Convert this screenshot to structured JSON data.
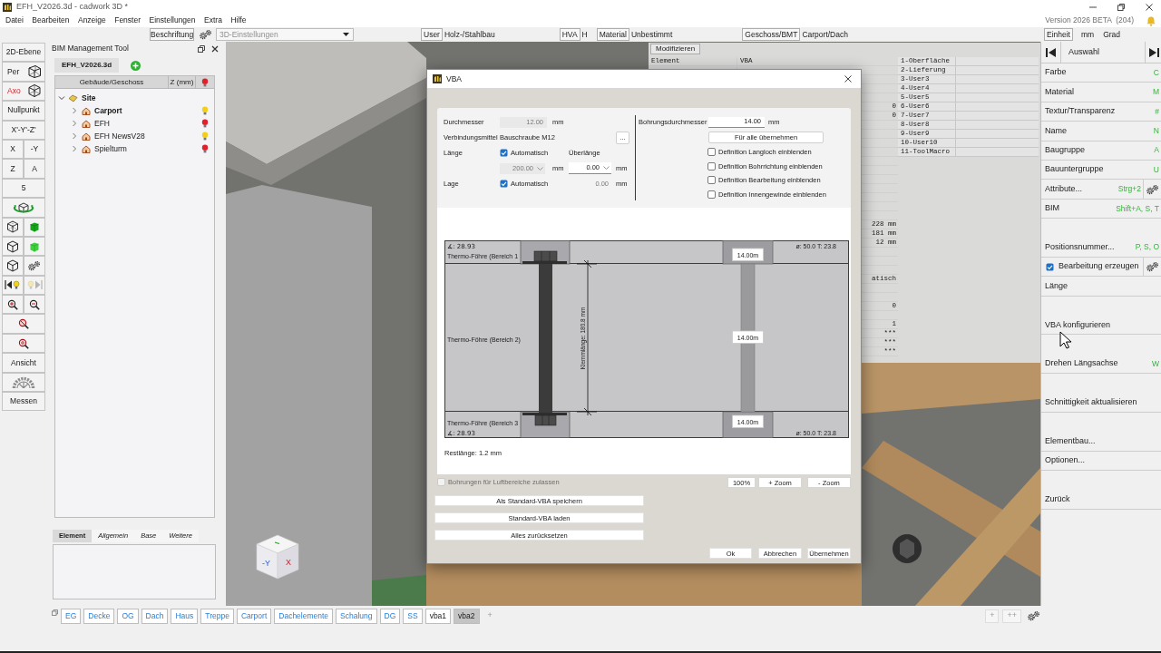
{
  "title_bar": {
    "title": "EFH_V2026.3d - cadwork 3D *"
  },
  "menu_bar": {
    "items": [
      "Datei",
      "Bearbeiten",
      "Anzeige",
      "Fenster",
      "Einstellungen",
      "Extra",
      "Hilfe"
    ],
    "version": "Version 2026 BETA  (204)"
  },
  "toolbar": {
    "label_button": "Beschriftung",
    "settings_dropdown": {
      "value": "3D-Einstellungen",
      "disabled": true
    },
    "groups": [
      {
        "button": "User",
        "values": [
          "Holz-/Stahlbau"
        ]
      },
      {
        "button": "HVA",
        "values": [
          "H"
        ]
      },
      {
        "button": "Material",
        "values": [
          "Unbestimmt"
        ]
      },
      {
        "button": "Geschoss/BMT",
        "values": [
          "Carport/Dach"
        ]
      },
      {
        "button": "Einheit",
        "values": [
          "mm",
          "Grad"
        ]
      }
    ]
  },
  "left_toolbar": [
    {
      "kind": "text",
      "label": "2D-Ebene"
    },
    {
      "kind": "view",
      "label": "Per",
      "selected": false
    },
    {
      "kind": "view",
      "label": "Axo",
      "selected": true
    },
    {
      "kind": "text",
      "label": "Nullpunkt"
    },
    {
      "kind": "text",
      "label": "X'-Y'-Z'"
    },
    {
      "kind": "pair",
      "labels": [
        "X",
        "-Y"
      ]
    },
    {
      "kind": "pair",
      "labels": [
        "Z",
        "A"
      ]
    },
    {
      "kind": "text",
      "label": "5"
    },
    {
      "kind": "icons",
      "buttons": [
        {
          "disabled": false
        }
      ]
    },
    {
      "kind": "icons",
      "buttons": [
        {
          "disabled": false
        },
        {
          "disabled": false
        }
      ]
    },
    {
      "kind": "icons",
      "buttons": [
        {
          "disabled": false
        },
        {
          "disabled": false
        }
      ]
    },
    {
      "kind": "icons",
      "buttons": [
        {
          "disabled": false
        },
        {
          "disabled": false
        }
      ]
    },
    {
      "kind": "icons",
      "buttons": [
        {
          "disabled": false
        },
        {
          "disabled": true
        }
      ]
    },
    {
      "kind": "icons",
      "buttons": [
        {
          "disabled": false
        },
        {
          "disabled": false
        }
      ]
    },
    {
      "kind": "icons",
      "buttons": [
        {
          "disabled": false
        }
      ]
    },
    {
      "kind": "icons",
      "buttons": [
        {
          "disabled": false
        }
      ]
    },
    {
      "kind": "text",
      "label": "Ansicht"
    },
    {
      "kind": "icons",
      "buttons": [
        {
          "disabled": false
        }
      ]
    },
    {
      "kind": "text",
      "label": "Messen"
    }
  ],
  "bim_panel": {
    "title": "BIM Management Tool",
    "file_tab": "EFH_V2026.3d",
    "columns": [
      "Gebäude/Geschoss",
      "Z (mm)"
    ],
    "tree": [
      {
        "label": "Site",
        "expanded": true,
        "children": [
          {
            "label": "Carport",
            "active": true,
            "expanded": false,
            "light_on": true
          },
          {
            "label": "EFH",
            "active": false,
            "expanded": false,
            "light_on": false
          },
          {
            "label": "EFH NewsV28",
            "active": false,
            "expanded": false,
            "light_on": true
          },
          {
            "label": "Spielturm",
            "active": false,
            "expanded": false,
            "light_on": false
          }
        ]
      }
    ],
    "detail_tabs": [
      {
        "label": "Element",
        "selected": true
      },
      {
        "label": "Allgemein",
        "selected": false
      },
      {
        "label": "Base",
        "selected": false
      },
      {
        "label": "Weitere",
        "selected": false
      }
    ]
  },
  "viewport": {
    "info_panel": {
      "tab": "Modifizieren",
      "row_label": "Element",
      "row_value": "VBA",
      "values": [
        "0",
        "0",
        "228 mm",
        "181 mm",
        "12 mm",
        "atisch",
        "0",
        "1",
        "***",
        "***",
        "***"
      ]
    },
    "attribute_list": [
      "1-Oberfläche",
      "2-Lieferung",
      "3-User3",
      "4-User4",
      "5-User5",
      "6-User6",
      "7-User7",
      "8-User8",
      "9-User9",
      "10-User10",
      "11-ToolMacro"
    ],
    "nav_cube": {
      "labels": [
        "-Y",
        "X"
      ]
    }
  },
  "dialog": {
    "title": "VBA",
    "diameter": {
      "label": "Durchmesser",
      "value": "12.00",
      "unit": "mm",
      "disabled": true
    },
    "connector": {
      "label": "Verbindungsmittel",
      "value": "Bauschraube M12",
      "button": "..."
    },
    "length": {
      "label": "Länge",
      "auto": {
        "label": "Automatisch",
        "checked": true
      },
      "value": "200.00",
      "unit": "mm",
      "disabled": true
    },
    "overlength": {
      "label": "Überlänge",
      "value": "0.00",
      "unit": "mm"
    },
    "position": {
      "label": "Lage",
      "auto": {
        "label": "Automatisch",
        "checked": true
      },
      "value": "0.00",
      "unit": "mm",
      "disabled": true
    },
    "bore_diameter": {
      "label": "Bohrungsdurchmesser",
      "value": "14.00",
      "unit": "mm"
    },
    "apply_all_button": "Für alle übernehmen",
    "options": [
      {
        "label": "Definition Langloch einblenden",
        "checked": false
      },
      {
        "label": "Definition Bohrrichtung einblenden",
        "checked": false
      },
      {
        "label": "Definition Bearbeitung einblenden",
        "checked": false
      },
      {
        "label": "Definition Innengewinde einblenden",
        "checked": false
      }
    ],
    "diagram": {
      "layers": [
        "Thermo-Föhre (Bereich 1",
        "Thermo-Föhre (Bereich 2)",
        "Thermo-Föhre (Bereich 3"
      ],
      "angles": [
        "∡: 28.93",
        "∡: 28.93"
      ],
      "ring_notes": [
        "ø: 50.0 T: 23.8",
        "ø: 50.0 T: 23.8"
      ],
      "clamp_length": "Klemmlänge: 180.8 mm",
      "hole_labels": [
        "14.00m",
        "14.00m",
        "14.00m"
      ],
      "rest_length": "Restlänge: 1.2 mm"
    },
    "air_gap_option": {
      "label": "Bohrungen für Luftbereiche zulassen",
      "checked": false,
      "disabled": true
    },
    "zoom_buttons": [
      "100%",
      "+ Zoom",
      "- Zoom"
    ],
    "standard_buttons": [
      "Als Standard-VBA speichern",
      "Standard-VBA laden",
      "Alles zurücksetzen"
    ],
    "buttons": [
      "Ok",
      "Abbrechen",
      "Übernehmen"
    ]
  },
  "right_panel": {
    "header": "Auswahl",
    "groups": [
      [
        {
          "kind": "plain",
          "label": "Farbe",
          "shortcut": "C"
        },
        {
          "kind": "plain",
          "label": "Material",
          "shortcut": "M"
        },
        {
          "kind": "plain",
          "label": "Textur/Transparenz",
          "shortcut": "#"
        },
        {
          "kind": "plain",
          "label": "Name",
          "shortcut": "N"
        },
        {
          "kind": "plain",
          "label": "Baugruppe",
          "shortcut": "A"
        },
        {
          "kind": "plain",
          "label": "Bauuntergruppe",
          "shortcut": "U"
        },
        {
          "kind": "gear",
          "label": "Attribute...",
          "shortcut": "Strg+2"
        },
        {
          "kind": "plain",
          "label": "BIM",
          "shortcut": "Shift+A, S, T"
        }
      ],
      [
        {
          "kind": "plain",
          "label": "Positionsnummer...",
          "shortcut": "P, S, O"
        },
        {
          "kind": "check",
          "label": "Bearbeitung erzeugen",
          "checked": true
        },
        {
          "kind": "plain",
          "label": "Länge"
        }
      ],
      [
        {
          "kind": "plain",
          "label": "VBA konfigurieren"
        }
      ],
      [
        {
          "kind": "plain",
          "label": "Drehen Längsachse",
          "shortcut": "W"
        }
      ],
      [
        {
          "kind": "plain",
          "label": "Schnittigkeit aktualisieren"
        }
      ],
      [
        {
          "kind": "plain",
          "label": "Elementbau..."
        },
        {
          "kind": "plain",
          "label": "Optionen..."
        }
      ],
      [
        {
          "kind": "plain",
          "label": "Zurück"
        }
      ]
    ]
  },
  "sheet_tabs": [
    {
      "label": "EG",
      "kind": "layer",
      "selected": false
    },
    {
      "label": "Decke",
      "kind": "layer",
      "selected": false
    },
    {
      "label": "OG",
      "kind": "layer",
      "selected": false
    },
    {
      "label": "Dach",
      "kind": "layer",
      "selected": false
    },
    {
      "label": "Haus",
      "kind": "layer",
      "selected": false
    },
    {
      "label": "Treppe",
      "kind": "layer",
      "selected": false
    },
    {
      "label": "Carport",
      "kind": "layer",
      "selected": false
    },
    {
      "label": "Dachelemente",
      "kind": "layer",
      "selected": false
    },
    {
      "label": "Schalung",
      "kind": "layer",
      "selected": false
    },
    {
      "label": "DG",
      "kind": "layer",
      "selected": false
    },
    {
      "label": "SS",
      "kind": "layer",
      "selected": false
    },
    {
      "label": "vba1",
      "kind": "custom",
      "selected": false
    },
    {
      "label": "vba2",
      "kind": "custom",
      "selected": true
    }
  ],
  "add_tab": "+",
  "tab_tools": [
    "+",
    "++"
  ]
}
